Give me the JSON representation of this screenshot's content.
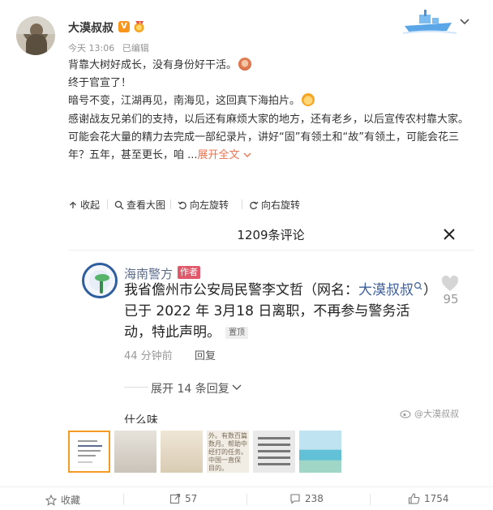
{
  "post": {
    "author": "大漠叔叔",
    "verified_badge": "V",
    "time": "今天 13:06",
    "edited": "已编辑",
    "lines": [
      "背靠大树好成长，没有身份好干活。",
      "终于官宣了！",
      "暗号不变，江湖再见，南海见，这回真下海拍片。",
      "感谢战友兄弟们的支持，以后还有麻烦大家的地方，还有老乡，以后宣传农村靠大家。",
      "可能会花大量的精力去完成一部纪录片，讲好“固”有领土和“故”有领土，可能会花三年？五年，甚至更长，咱 ..."
    ],
    "expand_label": "展开全文"
  },
  "toolbar": {
    "collapse": "收起",
    "view_large": "查看大图",
    "rotate_left": "向左旋转",
    "rotate_right": "向右旋转"
  },
  "screenshot": {
    "title": "1209条评论",
    "commenter": "海南警方",
    "tag": "作者",
    "text_before": "我省儋州市公安局民警李文哲（网名：",
    "text_link": "大漠叔叔",
    "text_after": "）已于 2022 年 3月18 日离职，不再参与警务活动，特此声明。",
    "pinned": "置顶",
    "likes": "95",
    "time": "44 分钟前",
    "reply": "回复",
    "expand_replies": "展开 14 条回复",
    "next_comment": "什么味",
    "watermark": "@大漠叔叔"
  },
  "thumbnails": {
    "t4_text": "外。有数百篇 数月。帮助中 经打的任务。 中国一直保 目的。"
  },
  "actions": {
    "favorite": "收藏",
    "repost": "57",
    "comment": "238",
    "like": "1754"
  },
  "colors": {
    "accent_orange": "#eb7350",
    "link_blue": "#3d5f9e",
    "author_tag": "#e0596a"
  }
}
